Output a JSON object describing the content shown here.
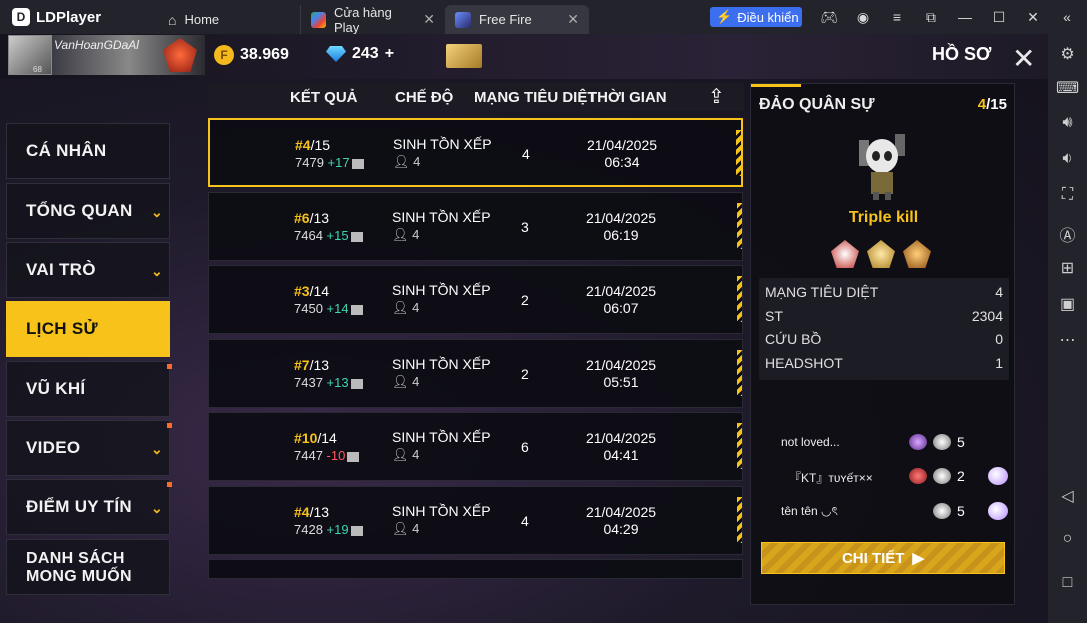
{
  "titlebar": {
    "app_name": "LDPlayer",
    "tabs": [
      {
        "label": "Home"
      },
      {
        "label": "Cửa hàng Play"
      },
      {
        "label": "Free Fire"
      }
    ],
    "control_button": "Điều khiển"
  },
  "profile": {
    "username": "VanHoanGDaAl",
    "level": "68",
    "gold": "38.969",
    "diamonds": "243",
    "diamond_add": "+",
    "screen_title": "HỒ SƠ"
  },
  "menu": [
    {
      "label": "CÁ NHÂN"
    },
    {
      "label": "TỔNG QUAN"
    },
    {
      "label": "VAI TRÒ"
    },
    {
      "label": "LỊCH SỬ"
    },
    {
      "label": "VŨ KHÍ"
    },
    {
      "label": "VIDEO"
    },
    {
      "label": "ĐIỂM UY TÍN"
    },
    {
      "label": "DANH SÁCH MONG MUỐN"
    }
  ],
  "table": {
    "headers": {
      "result": "KẾT QUẢ",
      "mode": "CHẾ ĐỘ",
      "kills": "MẠNG TIÊU DIỆT",
      "time": "THỜI GIAN"
    },
    "rows": [
      {
        "rank": "#4",
        "total": "/15",
        "points": "7479",
        "delta": "+17",
        "mode": "SINH TỒN XẾP HẠ",
        "players": "4",
        "kills": "4",
        "date": "21/04/2025",
        "time": "06:34"
      },
      {
        "rank": "#6",
        "total": "/13",
        "points": "7464",
        "delta": "+15",
        "mode": "SINH TỒN XẾP HẠ",
        "players": "4",
        "kills": "3",
        "date": "21/04/2025",
        "time": "06:19"
      },
      {
        "rank": "#3",
        "total": "/14",
        "points": "7450",
        "delta": "+14",
        "mode": "SINH TỒN XẾP HẠ",
        "players": "4",
        "kills": "2",
        "date": "21/04/2025",
        "time": "06:07"
      },
      {
        "rank": "#7",
        "total": "/13",
        "points": "7437",
        "delta": "+13",
        "mode": "SINH TỒN XẾP HẠ",
        "players": "4",
        "kills": "2",
        "date": "21/04/2025",
        "time": "05:51"
      },
      {
        "rank": "#10",
        "total": "/14",
        "points": "7447",
        "delta": "-10",
        "mode": "SINH TỒN XẾP HẠ",
        "players": "4",
        "kills": "6",
        "date": "21/04/2025",
        "time": "04:41"
      },
      {
        "rank": "#4",
        "total": "/13",
        "points": "7428",
        "delta": "+19",
        "mode": "SINH TỒN XẾP HẠ",
        "players": "4",
        "kills": "4",
        "date": "21/04/2025",
        "time": "04:29"
      }
    ]
  },
  "detail": {
    "map": "ĐẢO QUÂN SỰ",
    "rank": "4",
    "total": "/15",
    "achievement": "Triple kill",
    "stats": [
      {
        "label": "MẠNG TIÊU DIỆT",
        "value": "4"
      },
      {
        "label": "ST",
        "value": "2304"
      },
      {
        "label": "CỨU BỒ",
        "value": "0"
      },
      {
        "label": "HEADSHOT",
        "value": "1"
      }
    ],
    "team": [
      {
        "name": "not loved...",
        "value": "5"
      },
      {
        "name": "『KT』ᴛᴜʏếᴛ××",
        "value": "2"
      },
      {
        "name": "tên tên ◡ৎ",
        "value": "5"
      }
    ],
    "detail_button": "CHI TIẾT"
  }
}
